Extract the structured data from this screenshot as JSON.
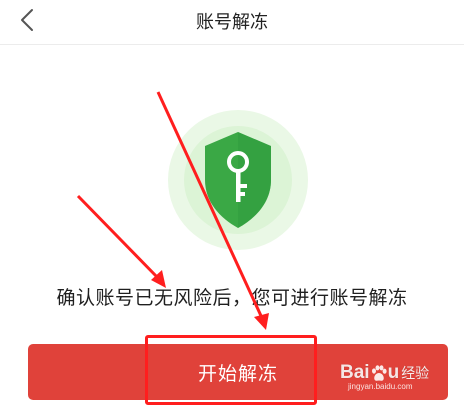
{
  "header": {
    "title": "账号解冻",
    "back_icon": "chevron-left-icon"
  },
  "illustration": {
    "icon": "shield-key-icon",
    "shield_color": "#3aa845",
    "halo_color": "#e3f6de"
  },
  "notice": {
    "text": "确认账号已无风险后，您可进行账号解冻"
  },
  "primary_button": {
    "label": "开始解冻",
    "color": "#e0423a"
  },
  "annotation": {
    "highlight_color": "#ff1e1e",
    "arrow_color": "#ff1e1e"
  },
  "watermark": {
    "logo_left": "Bai",
    "logo_right": "u",
    "text": "经验",
    "url": "jingyan.baidu.com"
  }
}
